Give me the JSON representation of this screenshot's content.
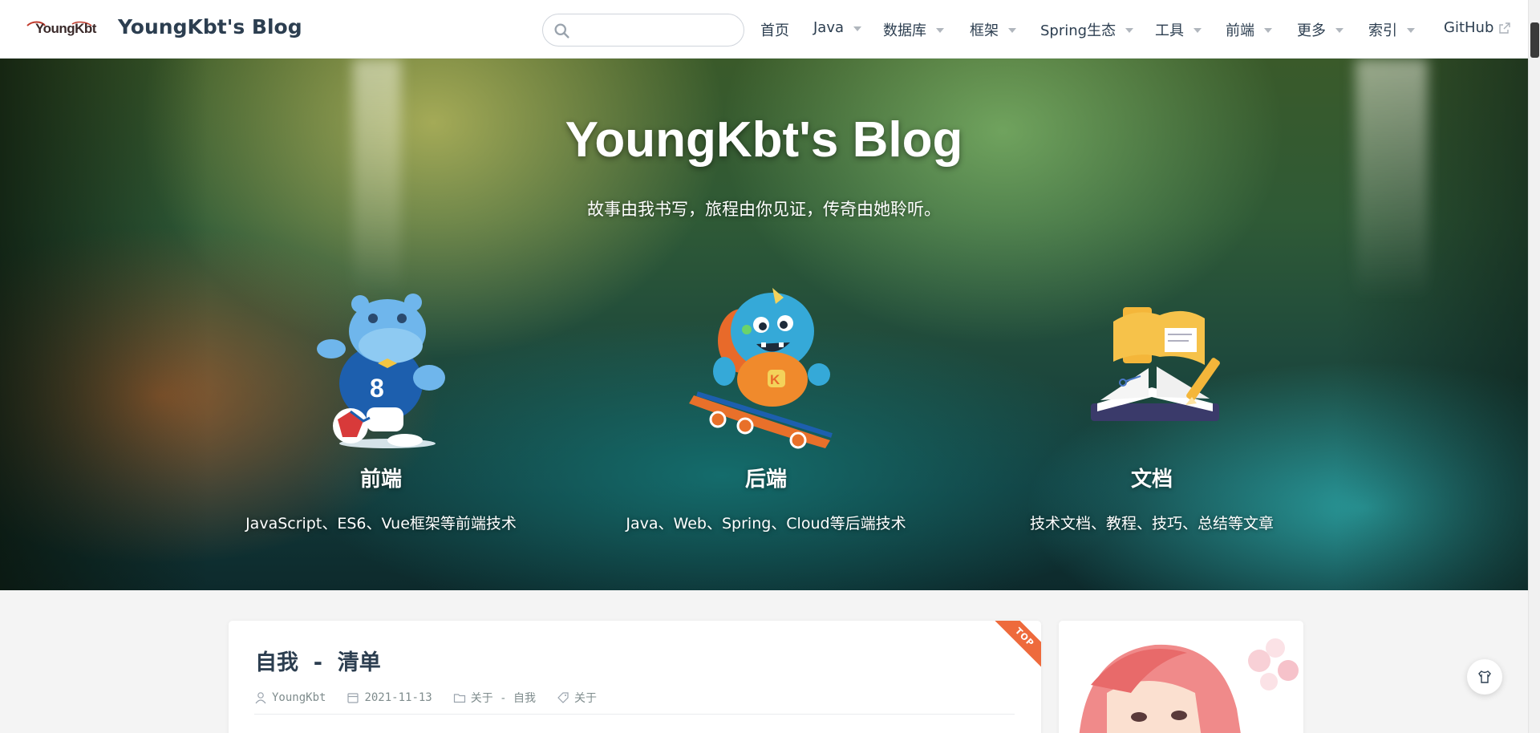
{
  "navbar": {
    "logo_text": "YoungKbt",
    "site_name": "YoungKbt's Blog",
    "search": {
      "placeholder": "",
      "value": ""
    },
    "links": [
      {
        "label": "首页",
        "dropdown": false
      },
      {
        "label": "Java",
        "dropdown": true
      },
      {
        "label": "数据库",
        "dropdown": true
      },
      {
        "label": "框架",
        "dropdown": true
      },
      {
        "label": "Spring生态",
        "dropdown": true
      },
      {
        "label": "工具",
        "dropdown": true
      },
      {
        "label": "前端",
        "dropdown": true
      },
      {
        "label": "更多",
        "dropdown": true
      },
      {
        "label": "索引",
        "dropdown": true
      },
      {
        "label": "GitHub",
        "external": true
      }
    ]
  },
  "hero": {
    "title": "YoungKbt's Blog",
    "subtitle": "故事由我书写，旅程由你见证，传奇由她聆听。",
    "features": [
      {
        "title": "前端",
        "desc": "JavaScript、ES6、Vue框架等前端技术",
        "icon": "hippo-mascot-icon"
      },
      {
        "title": "后端",
        "desc": "Java、Web、Spring、Cloud等后端技术",
        "icon": "monster-skateboard-icon"
      },
      {
        "title": "文档",
        "desc": "技术文档、教程、技巧、总结等文章",
        "icon": "open-book-icon"
      }
    ]
  },
  "post": {
    "badge": "TOP",
    "title": "自我 - 清单",
    "author": "YoungKbt",
    "date": "2021-11-13",
    "category": "关于 - 自我",
    "tag": "关于"
  },
  "colors": {
    "accent": "#ee6a3c",
    "text": "#2c3e50",
    "meta": "#7f8c8d"
  }
}
